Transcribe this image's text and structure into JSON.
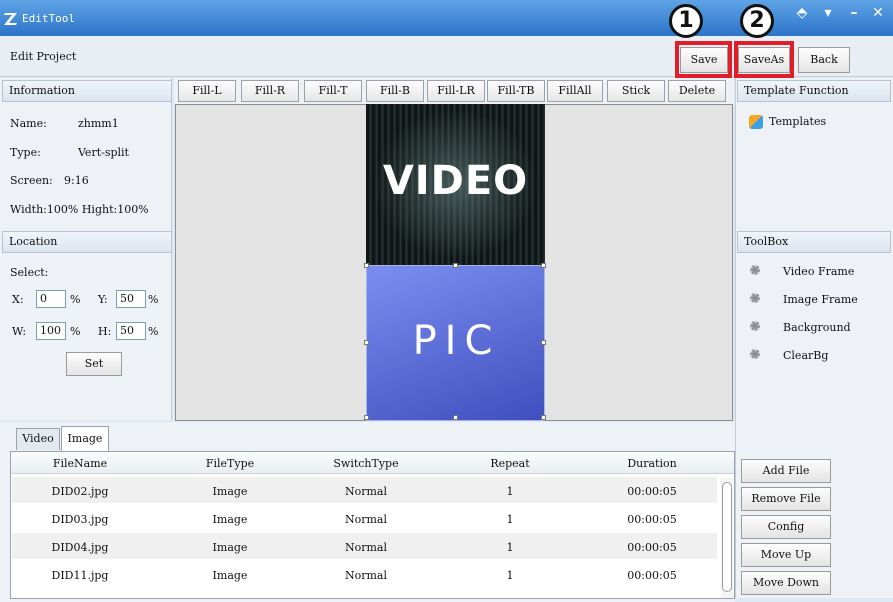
{
  "window": {
    "title": "EditTool",
    "buttons": [
      "⬘",
      "▾",
      "–",
      "✕"
    ]
  },
  "header": {
    "title": "Edit Project",
    "save_label": "Save",
    "saveas_label": "SaveAs",
    "back_label": "Back",
    "badge1": "1",
    "badge2": "2"
  },
  "info": {
    "heading": "Information",
    "name_label": "Name:",
    "name_value": "zhmm1",
    "type_label": "Type:",
    "type_value": "Vert-split",
    "screen_label": "Screen:",
    "screen_value": "9:16",
    "size_text": "Width:100% Hight:100%"
  },
  "location": {
    "heading": "Location",
    "select_label": "Select:",
    "x_label": "X:",
    "x_value": "0",
    "y_label": "Y:",
    "y_value": "50",
    "w_label": "W:",
    "w_value": "100",
    "h_label": "H:",
    "h_value": "50",
    "pct": "%",
    "set_label": "Set"
  },
  "toolbar": [
    "Fill-L",
    "Fill-R",
    "Fill-T",
    "Fill-B",
    "Fill-LR",
    "Fill-TB",
    "FillAll",
    "Stick",
    "Delete"
  ],
  "canvas": {
    "video_label": "VIDEO",
    "pic_label": "PIC"
  },
  "template": {
    "heading": "Template Function",
    "templates_label": "Templates"
  },
  "toolbox": {
    "heading": "ToolBox",
    "items": [
      "Video Frame",
      "Image Frame",
      "Background",
      "ClearBg"
    ]
  },
  "tabs": [
    "Video",
    "Image"
  ],
  "table": {
    "headers": [
      "FileName",
      "FileType",
      "SwitchType",
      "Repeat",
      "Duration"
    ],
    "rows": [
      [
        "DID02.jpg",
        "Image",
        "Normal",
        "1",
        "00:00:05"
      ],
      [
        "DID03.jpg",
        "Image",
        "Normal",
        "1",
        "00:00:05"
      ],
      [
        "DID04.jpg",
        "Image",
        "Normal",
        "1",
        "00:00:05"
      ],
      [
        "DID11.jpg",
        "Image",
        "Normal",
        "1",
        "00:00:05"
      ]
    ]
  },
  "file_buttons": [
    "Add File",
    "Remove File",
    "Config",
    "Move Up",
    "Move Down"
  ],
  "colors": {
    "accent": "#2c74c9",
    "highlight": "#e01e2a",
    "pic_bg": "#5a6fd8",
    "video_bg": "#1e2626"
  }
}
